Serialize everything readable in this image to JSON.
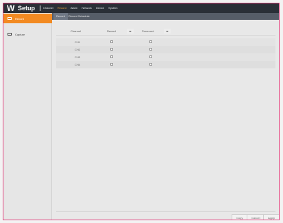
{
  "app": {
    "logo": "W",
    "title": "Setup"
  },
  "top_nav": {
    "items": [
      "Channel",
      "Record",
      "Alarm",
      "Network",
      "Device",
      "System"
    ],
    "active": "Record"
  },
  "sidebar": {
    "items": [
      {
        "label": "Record",
        "active": true
      },
      {
        "label": "Capture",
        "active": false
      }
    ]
  },
  "tabs": {
    "items": [
      "Record",
      "Record Schedule"
    ],
    "active": "Record"
  },
  "table": {
    "columns": [
      "Channel",
      "Record",
      "Prerecord"
    ],
    "rows": [
      {
        "channel": "CH1"
      },
      {
        "channel": "CH2"
      },
      {
        "channel": "CH3"
      },
      {
        "channel": "CH4"
      }
    ]
  },
  "buttons": {
    "copy": "Copy",
    "cancel": "Cancel",
    "apply": "Apply"
  },
  "colors": {
    "accent": "#f28a22",
    "topbar": "#2a2f37",
    "tab_bar": "#565d68",
    "frame_border": "#e3417d"
  }
}
